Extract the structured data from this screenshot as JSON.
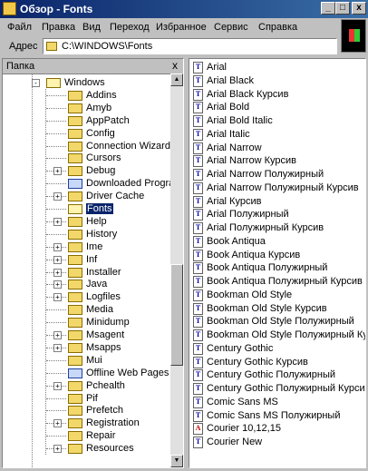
{
  "window": {
    "title": "Обзор - Fonts"
  },
  "titlebar_buttons": [
    "_",
    "□",
    "x"
  ],
  "menu": [
    {
      "label": "Файл"
    },
    {
      "label": "Правка"
    },
    {
      "label": "Вид"
    },
    {
      "label": "Переход"
    },
    {
      "label": "Избранное"
    },
    {
      "label": "Сервис"
    },
    {
      "label": "Справка"
    }
  ],
  "address": {
    "label": "Адрес",
    "value": "C:\\WINDOWS\\Fonts"
  },
  "folders_pane": {
    "title": "Папка",
    "close": "x"
  },
  "tree": [
    {
      "label": "Windows",
      "expander": "-",
      "level": 0,
      "open": true
    },
    {
      "label": "Addins",
      "level": 1
    },
    {
      "label": "Amyb",
      "level": 1
    },
    {
      "label": "AppPatch",
      "level": 1
    },
    {
      "label": "Config",
      "level": 1
    },
    {
      "label": "Connection Wizard",
      "level": 1
    },
    {
      "label": "Cursors",
      "level": 1
    },
    {
      "label": "Debug",
      "level": 1,
      "expander": "+"
    },
    {
      "label": "Downloaded Program Fi",
      "level": 1,
      "special": true
    },
    {
      "label": "Driver Cache",
      "level": 1,
      "expander": "+"
    },
    {
      "label": "Fonts",
      "level": 1,
      "selected": true
    },
    {
      "label": "Help",
      "level": 1,
      "expander": "+"
    },
    {
      "label": "History",
      "level": 1
    },
    {
      "label": "Ime",
      "level": 1,
      "expander": "+"
    },
    {
      "label": "Inf",
      "level": 1,
      "expander": "+"
    },
    {
      "label": "Installer",
      "level": 1,
      "expander": "+"
    },
    {
      "label": "Java",
      "level": 1,
      "expander": "+"
    },
    {
      "label": "Logfiles",
      "level": 1,
      "expander": "+"
    },
    {
      "label": "Media",
      "level": 1
    },
    {
      "label": "Minidump",
      "level": 1
    },
    {
      "label": "Msagent",
      "level": 1,
      "expander": "+"
    },
    {
      "label": "Msapps",
      "level": 1,
      "expander": "+"
    },
    {
      "label": "Mui",
      "level": 1
    },
    {
      "label": "Offline Web Pages",
      "level": 1,
      "special": true
    },
    {
      "label": "Pchealth",
      "level": 1,
      "expander": "+"
    },
    {
      "label": "Pif",
      "level": 1
    },
    {
      "label": "Prefetch",
      "level": 1
    },
    {
      "label": "Registration",
      "level": 1,
      "expander": "+"
    },
    {
      "label": "Repair",
      "level": 1
    },
    {
      "label": "Resources",
      "level": 1,
      "expander": "+"
    }
  ],
  "fonts": [
    {
      "name": "Arial",
      "type": "tt"
    },
    {
      "name": "Arial Black",
      "type": "tt"
    },
    {
      "name": "Arial Black Курсив",
      "type": "tt"
    },
    {
      "name": "Arial Bold",
      "type": "tt"
    },
    {
      "name": "Arial Bold Italic",
      "type": "tt"
    },
    {
      "name": "Arial Italic",
      "type": "tt"
    },
    {
      "name": "Arial Narrow",
      "type": "tt"
    },
    {
      "name": "Arial Narrow Курсив",
      "type": "tt"
    },
    {
      "name": "Arial Narrow Полужирный",
      "type": "tt"
    },
    {
      "name": "Arial Narrow Полужирный Курсив",
      "type": "tt"
    },
    {
      "name": "Arial Курсив",
      "type": "tt"
    },
    {
      "name": "Arial Полужирный",
      "type": "tt"
    },
    {
      "name": "Arial Полужирный Курсив",
      "type": "tt"
    },
    {
      "name": "Book Antiqua",
      "type": "tt"
    },
    {
      "name": "Book Antiqua Курсив",
      "type": "tt"
    },
    {
      "name": "Book Antiqua Полужирный",
      "type": "tt"
    },
    {
      "name": "Book Antiqua Полужирный Курсив",
      "type": "tt"
    },
    {
      "name": "Bookman Old Style",
      "type": "tt"
    },
    {
      "name": "Bookman Old Style Курсив",
      "type": "tt"
    },
    {
      "name": "Bookman Old Style Полужирный",
      "type": "tt"
    },
    {
      "name": "Bookman Old Style Полужирный Курсив",
      "type": "tt"
    },
    {
      "name": "Century Gothic",
      "type": "tt"
    },
    {
      "name": "Century Gothic Курсив",
      "type": "tt"
    },
    {
      "name": "Century Gothic Полужирный",
      "type": "tt"
    },
    {
      "name": "Century Gothic Полужирный Курсив",
      "type": "tt"
    },
    {
      "name": "Comic Sans MS",
      "type": "tt"
    },
    {
      "name": "Comic Sans MS Полужирный",
      "type": "tt"
    },
    {
      "name": "Courier 10,12,15",
      "type": "raster"
    },
    {
      "name": "Courier New",
      "type": "tt"
    }
  ],
  "colors": {
    "titlebar_start": "#0a246a",
    "titlebar_end": "#3a6ea5",
    "selection": "#0a246a",
    "face": "#c0c0c0"
  }
}
